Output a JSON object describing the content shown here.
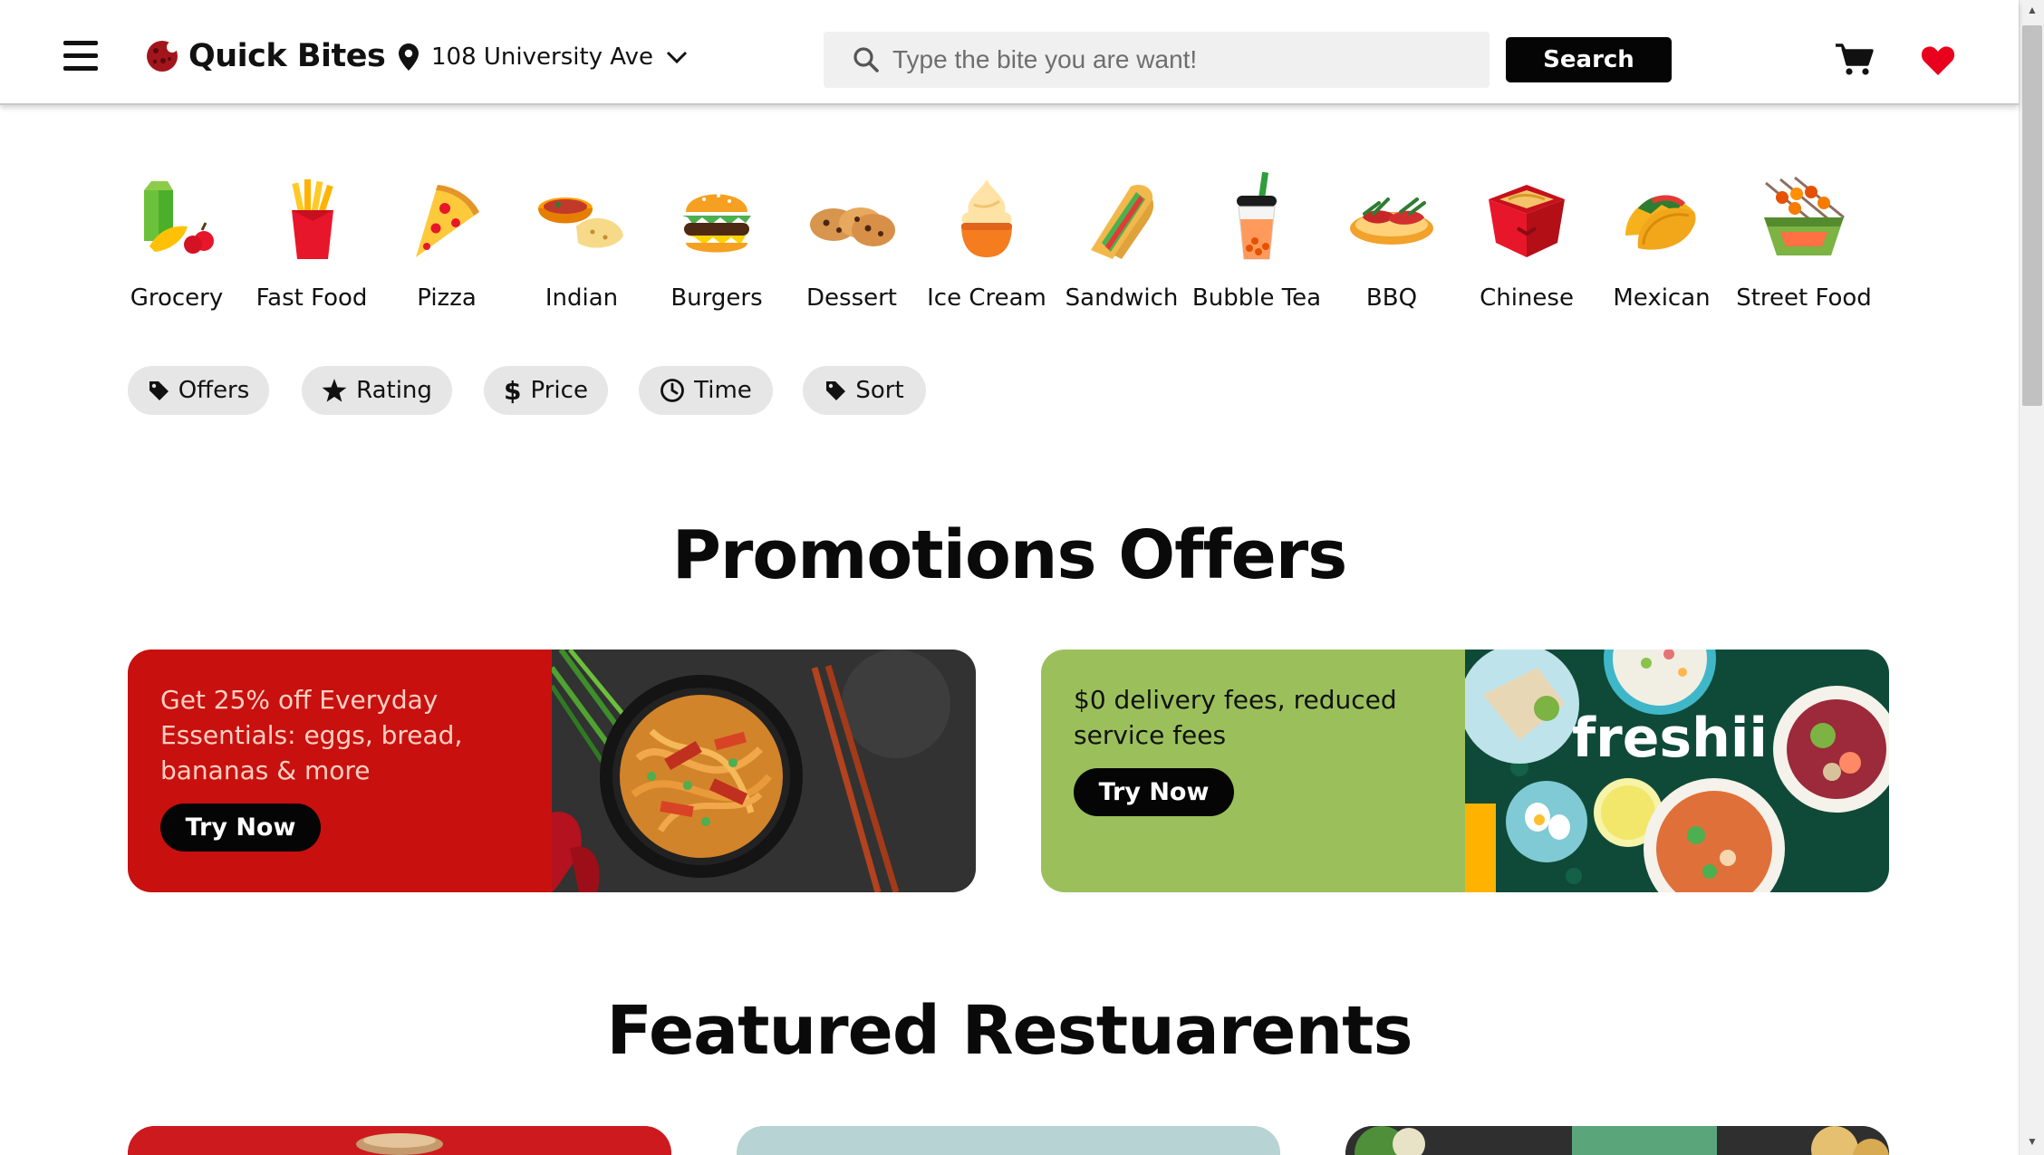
{
  "header": {
    "brand": "Quick Bites",
    "location": "108 University Ave",
    "search_placeholder": "Type the bite you are want!",
    "search_button": "Search"
  },
  "categories": [
    {
      "label": "Grocery"
    },
    {
      "label": "Fast Food"
    },
    {
      "label": "Pizza"
    },
    {
      "label": "Indian"
    },
    {
      "label": "Burgers"
    },
    {
      "label": "Dessert"
    },
    {
      "label": "Ice Cream"
    },
    {
      "label": "Sandwich"
    },
    {
      "label": "Bubble Tea"
    },
    {
      "label": "BBQ"
    },
    {
      "label": "Chinese"
    },
    {
      "label": "Mexican"
    },
    {
      "label": "Street Food"
    }
  ],
  "filters": [
    {
      "label": "Offers",
      "icon": "tag-icon"
    },
    {
      "label": "Rating",
      "icon": "star-icon"
    },
    {
      "label": "Price",
      "icon": "dollar-icon"
    },
    {
      "label": "Time",
      "icon": "clock-icon"
    },
    {
      "label": "Sort",
      "icon": "tag-icon"
    }
  ],
  "promotions": {
    "title": "Promotions Offers",
    "offers": [
      {
        "text": "Get 25% off Everyday Essentials: eggs, bread, bananas & more",
        "button": "Try Now",
        "color": "#c8100f"
      },
      {
        "text": "$0 delivery fees, reduced service fees",
        "button": "Try Now",
        "color": "#9bc05b",
        "brand": "freshii"
      }
    ]
  },
  "featured": {
    "title": "Featured Restuarents"
  },
  "colors": {
    "accent_red": "#e8001c",
    "search_button": "#050505",
    "chip_bg": "#e6e6e6"
  }
}
